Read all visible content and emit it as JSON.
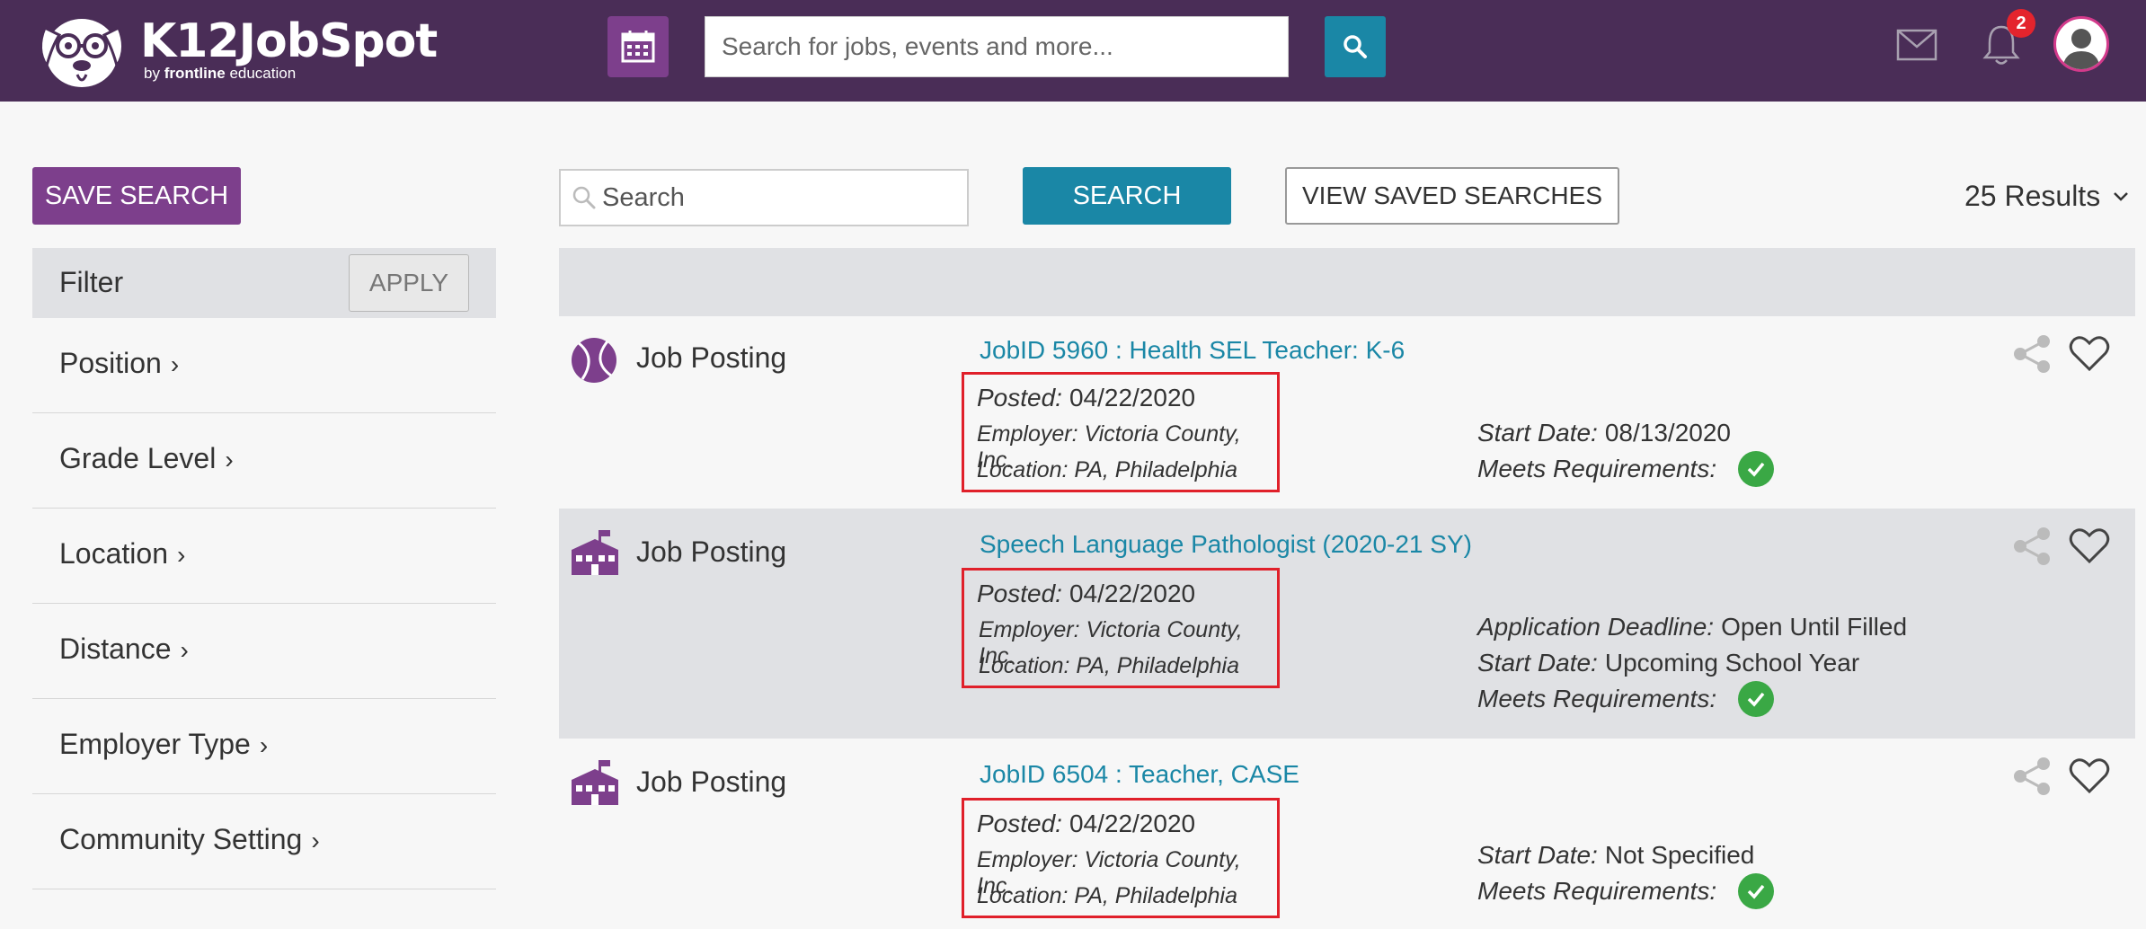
{
  "header": {
    "brand": "K12JobSpot",
    "brand_sub_prefix": "by",
    "brand_sub_bold": "frontline",
    "brand_sub_suffix": "education",
    "search_placeholder": "Search for jobs, events and more...",
    "notification_count": "2",
    "brand_color": "#4a2d57",
    "accent_color": "#1a87a6"
  },
  "sidebar": {
    "save_search_label": "SAVE SEARCH",
    "filter_title": "Filter",
    "apply_label": "APPLY",
    "filters": [
      {
        "label": "Position"
      },
      {
        "label": "Grade Level"
      },
      {
        "label": "Location"
      },
      {
        "label": "Distance"
      },
      {
        "label": "Employer Type"
      },
      {
        "label": "Community Setting"
      }
    ]
  },
  "toolbar": {
    "search_placeholder": "Search",
    "search_label": "SEARCH",
    "saved_searches_label": "VIEW SAVED SEARCHES",
    "results_label": "25 Results"
  },
  "postings": [
    {
      "icon": "tennis-ball-icon",
      "type": "Job Posting",
      "title": "JobID 5960 : Health SEL Teacher: K-6",
      "posted_key": "Posted:",
      "posted": "04/22/2020",
      "employer": "Employer: Victoria County, Inc.",
      "location": "Location: PA, Philadelphia",
      "details": [
        {
          "key": "Start Date:",
          "value": "08/13/2020"
        },
        {
          "key": "Meets Requirements:",
          "value": ""
        }
      ]
    },
    {
      "icon": "school-building-icon",
      "type": "Job Posting",
      "title": "Speech Language Pathologist (2020-21 SY)",
      "posted_key": "Posted:",
      "posted": "04/22/2020",
      "employer": "Employer: Victoria County, Inc.",
      "location": "Location: PA, Philadelphia",
      "details": [
        {
          "key": "Application Deadline:",
          "value": "Open Until Filled"
        },
        {
          "key": "Start Date:",
          "value": "Upcoming School Year"
        },
        {
          "key": "Meets Requirements:",
          "value": ""
        }
      ]
    },
    {
      "icon": "school-building-icon",
      "type": "Job Posting",
      "title": "JobID 6504 : Teacher, CASE",
      "posted_key": "Posted:",
      "posted": "04/22/2020",
      "employer": "Employer: Victoria County, Inc.",
      "location": "Location: PA, Philadelphia",
      "details": [
        {
          "key": "Start Date:",
          "value": "Not Specified"
        },
        {
          "key": "Meets Requirements:",
          "value": ""
        }
      ]
    }
  ]
}
